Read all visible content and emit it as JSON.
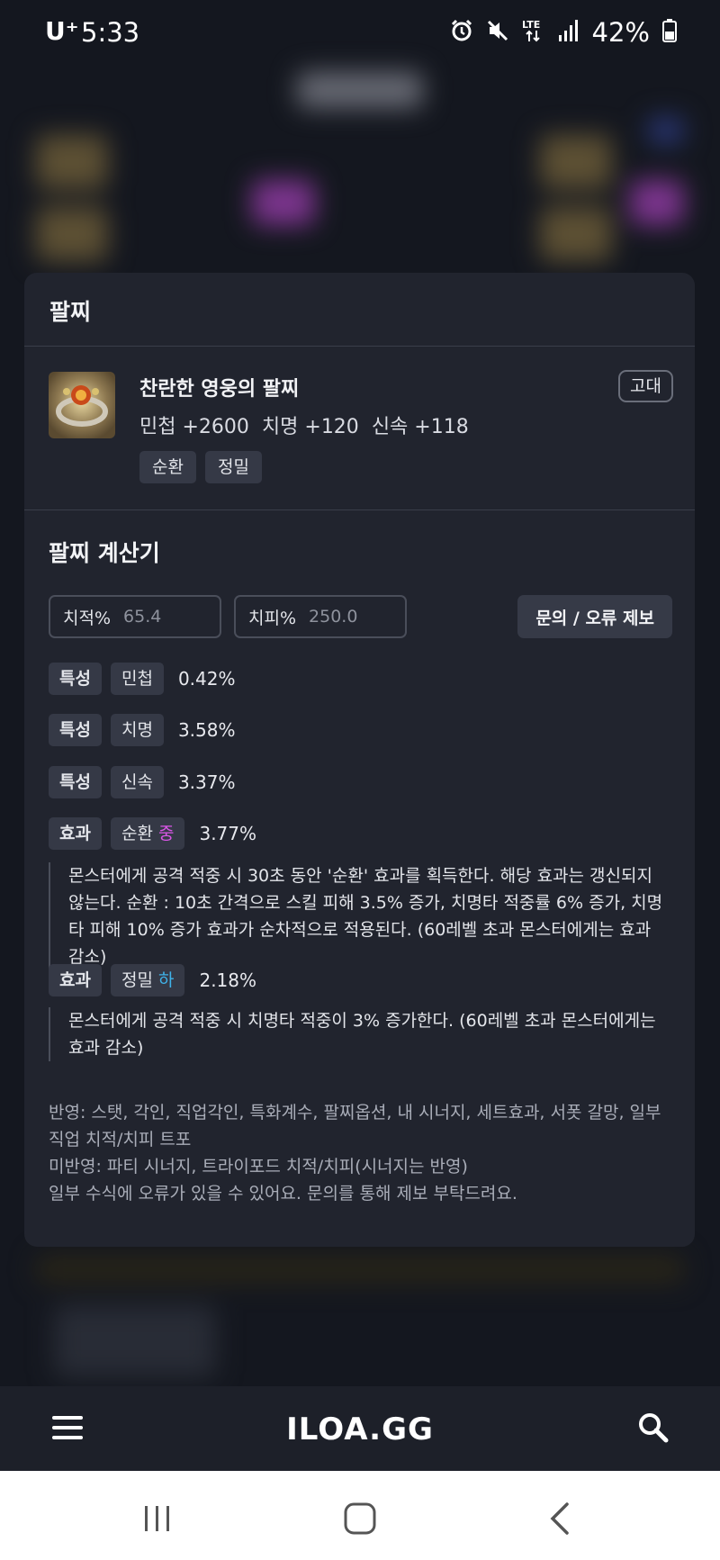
{
  "status_bar": {
    "carrier": "U⁺",
    "time": "5:33",
    "network": "LTE",
    "battery": "42%",
    "icons": [
      "alarm-icon",
      "mute-icon",
      "lte-icon",
      "signal-icon",
      "battery-icon"
    ]
  },
  "modal": {
    "title": "팔찌",
    "item": {
      "name": "찬란한 영웅의 팔찌",
      "stats": [
        "민첩 +2600",
        "치명 +120",
        "신속 +118"
      ],
      "grade": "고대",
      "tags": [
        "순환",
        "정밀"
      ]
    },
    "calculator": {
      "title": "팔찌 계산기",
      "crit_label": "치적%",
      "crit_value": "65.4",
      "critdmg_label": "치피%",
      "critdmg_value": "250.0",
      "report_button": "문의 / 오류 제보",
      "traits": [
        {
          "type": "특성",
          "name": "민첩",
          "value": "0.42%"
        },
        {
          "type": "특성",
          "name": "치명",
          "value": "3.58%"
        },
        {
          "type": "특성",
          "name": "신속",
          "value": "3.37%"
        }
      ],
      "effects": [
        {
          "type": "효과",
          "name": "순환",
          "level": "중",
          "value": "3.77%",
          "description": "몬스터에게 공격 적중 시 30초 동안 '순환' 효과를 획득한다. 해당 효과는 갱신되지 않는다. 순환 : 10초 간격으로 스킬 피해 3.5% 증가, 치명타 적중률 6% 증가, 치명타 피해 10% 증가 효과가 순차적으로 적용된다. (60레벨 초과 몬스터에게는 효과 감소)"
        },
        {
          "type": "효과",
          "name": "정밀",
          "level": "하",
          "value": "2.18%",
          "description": "몬스터에게 공격 적중 시 치명타 적중이 3% 증가한다. (60레벨 초과 몬스터에게는 효과 감소)"
        }
      ],
      "notes": [
        "반영: 스탯, 각인, 직업각인, 특화계수, 팔찌옵션, 내 시너지, 세트효과, 서폿 갈망, 일부 직업 치적/치피 트포",
        "미반영: 파티 시너지, 트라이포드 치적/치피(시너지는 반영)",
        "일부 수식에 오류가 있을 수 있어요. 문의를 통해 제보 부탁드려요."
      ]
    }
  },
  "app_bar": {
    "logo": "ILOA.GG",
    "menu_icon": "hamburger-menu-icon",
    "search_icon": "search-icon"
  },
  "colors": {
    "level_mid": "#d956e6",
    "level_low": "#3fb3ea",
    "card_bg": "#21242e",
    "page_bg": "#1b1e27"
  }
}
